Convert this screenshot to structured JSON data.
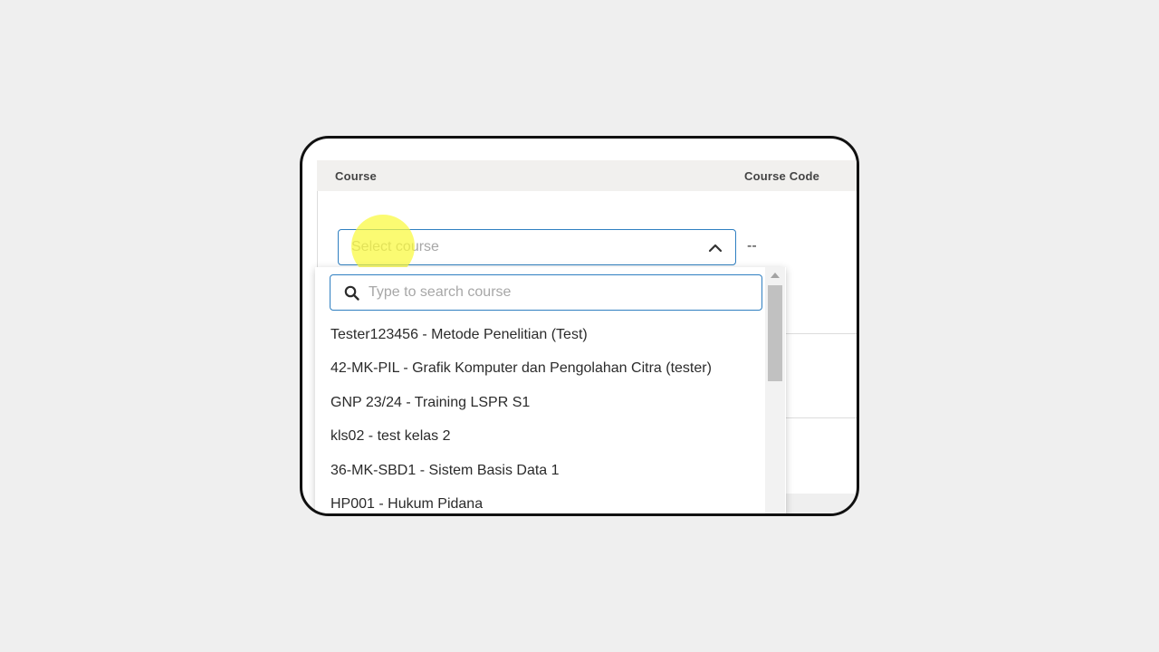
{
  "table": {
    "columns": [
      "Course",
      "Course Code"
    ]
  },
  "course_select": {
    "placeholder": "Select course",
    "code_value": "--",
    "chevron_icon": "chevron-up-icon"
  },
  "dropdown": {
    "search_placeholder": "Type to search course",
    "search_value": "",
    "search_icon": "search-icon",
    "options": [
      "Tester123456 - Metode Penelitian (Test)",
      "42-MK-PIL - Grafik Komputer dan Pengolahan Citra (tester)",
      "GNP 23/24 - Training LSPR S1",
      "kls02 - test kelas 2",
      "36-MK-SBD1 - Sistem Basis Data 1",
      "HP001 - Hukum Pidana"
    ]
  },
  "colors": {
    "accent": "#2f7fc1",
    "highlight": "#fafa3c",
    "header_bg": "#f1f0ee",
    "page_bg": "#efefef"
  }
}
